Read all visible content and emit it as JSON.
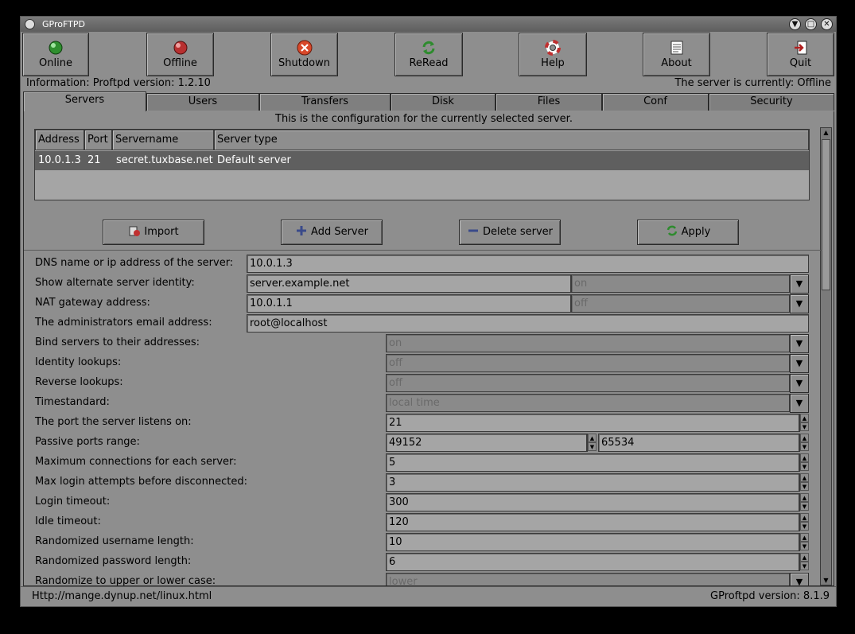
{
  "window": {
    "title": "GProFTPD"
  },
  "toolbar": [
    {
      "id": "online",
      "label": "Online",
      "icon": "green-led-icon",
      "color": "#2f8f2f"
    },
    {
      "id": "offline",
      "label": "Offline",
      "icon": "red-led-icon",
      "color": "#b83030"
    },
    {
      "id": "shutdown",
      "label": "Shutdown",
      "icon": "close-circle-icon",
      "color": "#d8482a"
    },
    {
      "id": "reread",
      "label": "ReRead",
      "icon": "refresh-icon",
      "color": "#2e8b2e"
    },
    {
      "id": "help",
      "label": "Help",
      "icon": "lifebuoy-icon",
      "color": "#c03030"
    },
    {
      "id": "about",
      "label": "About",
      "icon": "document-icon",
      "color": "#ffffff"
    },
    {
      "id": "quit",
      "label": "Quit",
      "icon": "exit-door-icon",
      "color": "#b02020"
    }
  ],
  "info": {
    "left": "Information: Proftpd version: 1.2.10",
    "right": "The server is currently: Offline"
  },
  "tabs": [
    "Servers",
    "Users",
    "Transfers",
    "Disk",
    "Files",
    "Conf",
    "Security"
  ],
  "panel": {
    "hint": "This is the configuration for the currently selected server."
  },
  "server_list": {
    "columns": [
      "Address",
      "Port",
      "Servername",
      "Server type"
    ],
    "rows": [
      [
        "10.0.1.3",
        "21",
        "secret.tuxbase.net",
        "Default server"
      ]
    ]
  },
  "actions": {
    "import": "Import",
    "add": "Add Server",
    "delete": "Delete server",
    "apply": "Apply"
  },
  "fields": {
    "dns": {
      "label": "DNS name or ip address of the server:",
      "value": "10.0.1.3"
    },
    "alt_identity": {
      "label": "Show alternate server identity:",
      "value": "server.example.net",
      "select": "on"
    },
    "nat": {
      "label": "NAT gateway address:",
      "value": "10.0.1.1",
      "select": "off"
    },
    "email": {
      "label": "The administrators email address:",
      "value": "root@localhost"
    },
    "bind": {
      "label": "Bind servers to their addresses:",
      "select": "on"
    },
    "ident": {
      "label": "Identity lookups:",
      "select": "off"
    },
    "reverse": {
      "label": "Reverse lookups:",
      "select": "off"
    },
    "timestd": {
      "label": "Timestandard:",
      "select": "local time"
    },
    "port": {
      "label": "The port the server listens on:",
      "value": "21"
    },
    "passive": {
      "label": "Passive ports range:",
      "from": "49152",
      "to": "65534"
    },
    "maxconn": {
      "label": "Maximum connections for each server:",
      "value": "5"
    },
    "maxlogin": {
      "label": "Max login attempts before disconnected:",
      "value": "3"
    },
    "logintimeout": {
      "label": "Login timeout:",
      "value": "300"
    },
    "idletimeout": {
      "label": "Idle timeout:",
      "value": "120"
    },
    "randuser": {
      "label": "Randomized username length:",
      "value": "10"
    },
    "randpass": {
      "label": "Randomized password length:",
      "value": "6"
    },
    "randcase": {
      "label": "Randomize to upper or lower case:",
      "select": "lower"
    }
  },
  "status": {
    "left": "Http://mange.dynup.net/linux.html",
    "right": "GProftpd version: 8.1.9"
  }
}
